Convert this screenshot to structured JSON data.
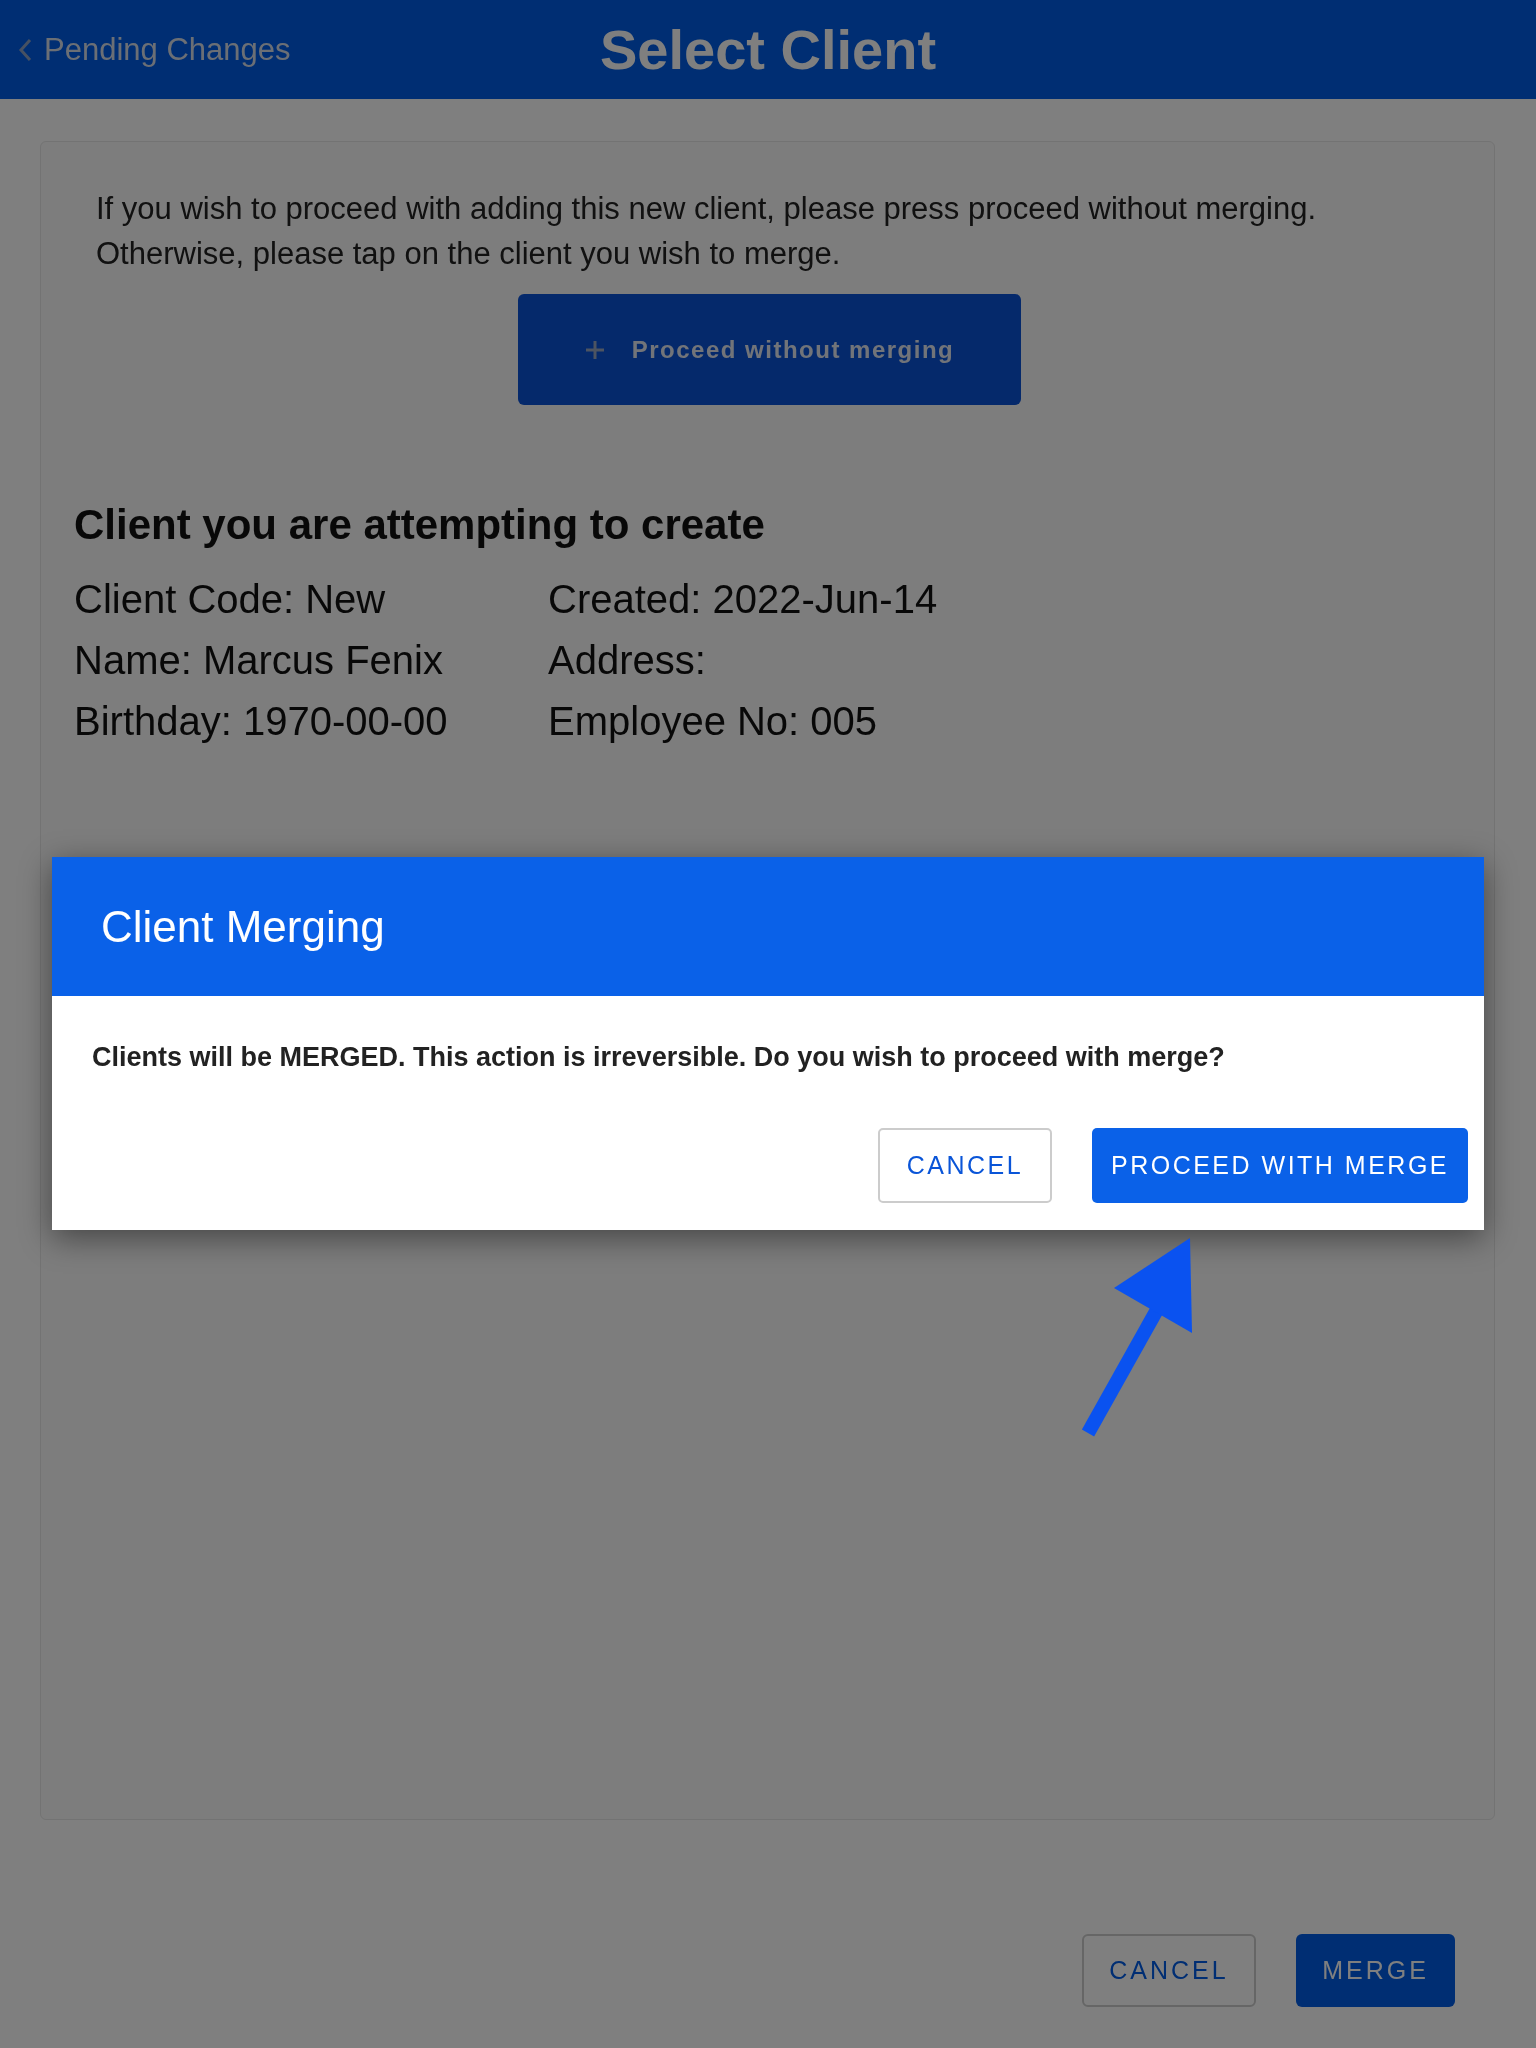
{
  "header": {
    "back_label": "Pending Changes",
    "title": "Select Client"
  },
  "instructions": "If you wish to proceed with adding this new client, please press proceed without merging. Otherwise, please tap on the client you wish to merge.",
  "proceed_button": {
    "label": "Proceed without merging"
  },
  "client_section": {
    "heading": "Client you are attempting to create",
    "fields": [
      {
        "text": "Client Code: New"
      },
      {
        "text": "Created: 2022-Jun-14"
      },
      {
        "text": "Name: Marcus Fenix"
      },
      {
        "text": "Address:"
      },
      {
        "text": "Birthday: 1970-00-00"
      },
      {
        "text": "Employee No: 005"
      }
    ]
  },
  "dialog": {
    "title": "Client Merging",
    "message": "Clients will be MERGED. This action is irreversible. Do you wish to proceed with merge?",
    "buttons": [
      {
        "label": "CANCEL",
        "kind": "outlined"
      },
      {
        "label": "PROCEED WITH MERGE",
        "kind": "filled"
      }
    ]
  },
  "footer_buttons": [
    {
      "label": "CANCEL",
      "kind": "outlined"
    },
    {
      "label": "MERGE",
      "kind": "filled"
    }
  ]
}
